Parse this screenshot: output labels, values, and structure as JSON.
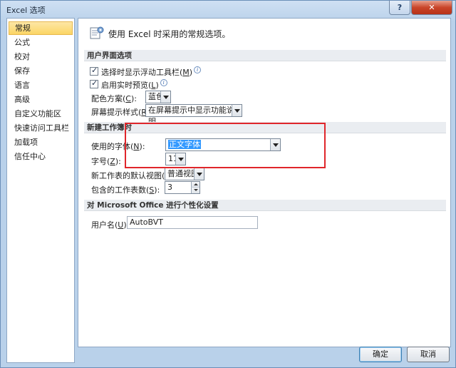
{
  "window": {
    "title": "Excel 选项",
    "help_label": "?",
    "close_label": "✕"
  },
  "sidebar": {
    "items": [
      {
        "label": "常规",
        "selected": true
      },
      {
        "label": "公式"
      },
      {
        "label": "校对"
      },
      {
        "label": "保存"
      },
      {
        "label": "语言"
      },
      {
        "label": "高级"
      },
      {
        "label": "自定义功能区"
      },
      {
        "label": "快速访问工具栏"
      },
      {
        "label": "加载项"
      },
      {
        "label": "信任中心"
      }
    ]
  },
  "header": {
    "text": "使用 Excel 时采用的常规选项。"
  },
  "ui_options": {
    "title": "用户界面选项",
    "mini_toolbar_label": "选择时显示浮动工具栏(",
    "mini_toolbar_key": "M",
    "mini_toolbar_suffix": ")",
    "live_preview_label": "启用实时预览(",
    "live_preview_key": "L",
    "live_preview_suffix": ")",
    "color_scheme_label": "配色方案(",
    "color_scheme_key": "C",
    "color_scheme_suffix": "):",
    "color_scheme_value": "蓝色",
    "screentip_label": "屏幕提示样式(",
    "screentip_key": "R",
    "screentip_suffix": "):",
    "screentip_value": "在屏幕提示中显示功能说明"
  },
  "new_workbook": {
    "title": "新建工作簿时",
    "font_label": "使用的字体(",
    "font_key": "N",
    "font_suffix": "):",
    "font_value": "正文字体",
    "size_label": "字号(",
    "size_key": "Z",
    "size_suffix": "):",
    "size_value": "11",
    "view_label": "新工作表的默认视图(",
    "view_key": "V",
    "view_suffix": "):",
    "view_value": "普通视图",
    "sheets_label": "包含的工作表数(",
    "sheets_key": "S",
    "sheets_suffix": "):",
    "sheets_value": "3"
  },
  "personalize": {
    "title": "对 Microsoft Office 进行个性化设置",
    "username_label": "用户名(",
    "username_key": "U",
    "username_suffix": "):",
    "username_value": "AutoBVT"
  },
  "footer": {
    "ok_label": "确定",
    "cancel_label": "取消"
  },
  "info_glyph": "i",
  "colors": {
    "highlight": "#e0262b",
    "selected_bg": "#fbd565",
    "text_selection": "#3399ff"
  }
}
